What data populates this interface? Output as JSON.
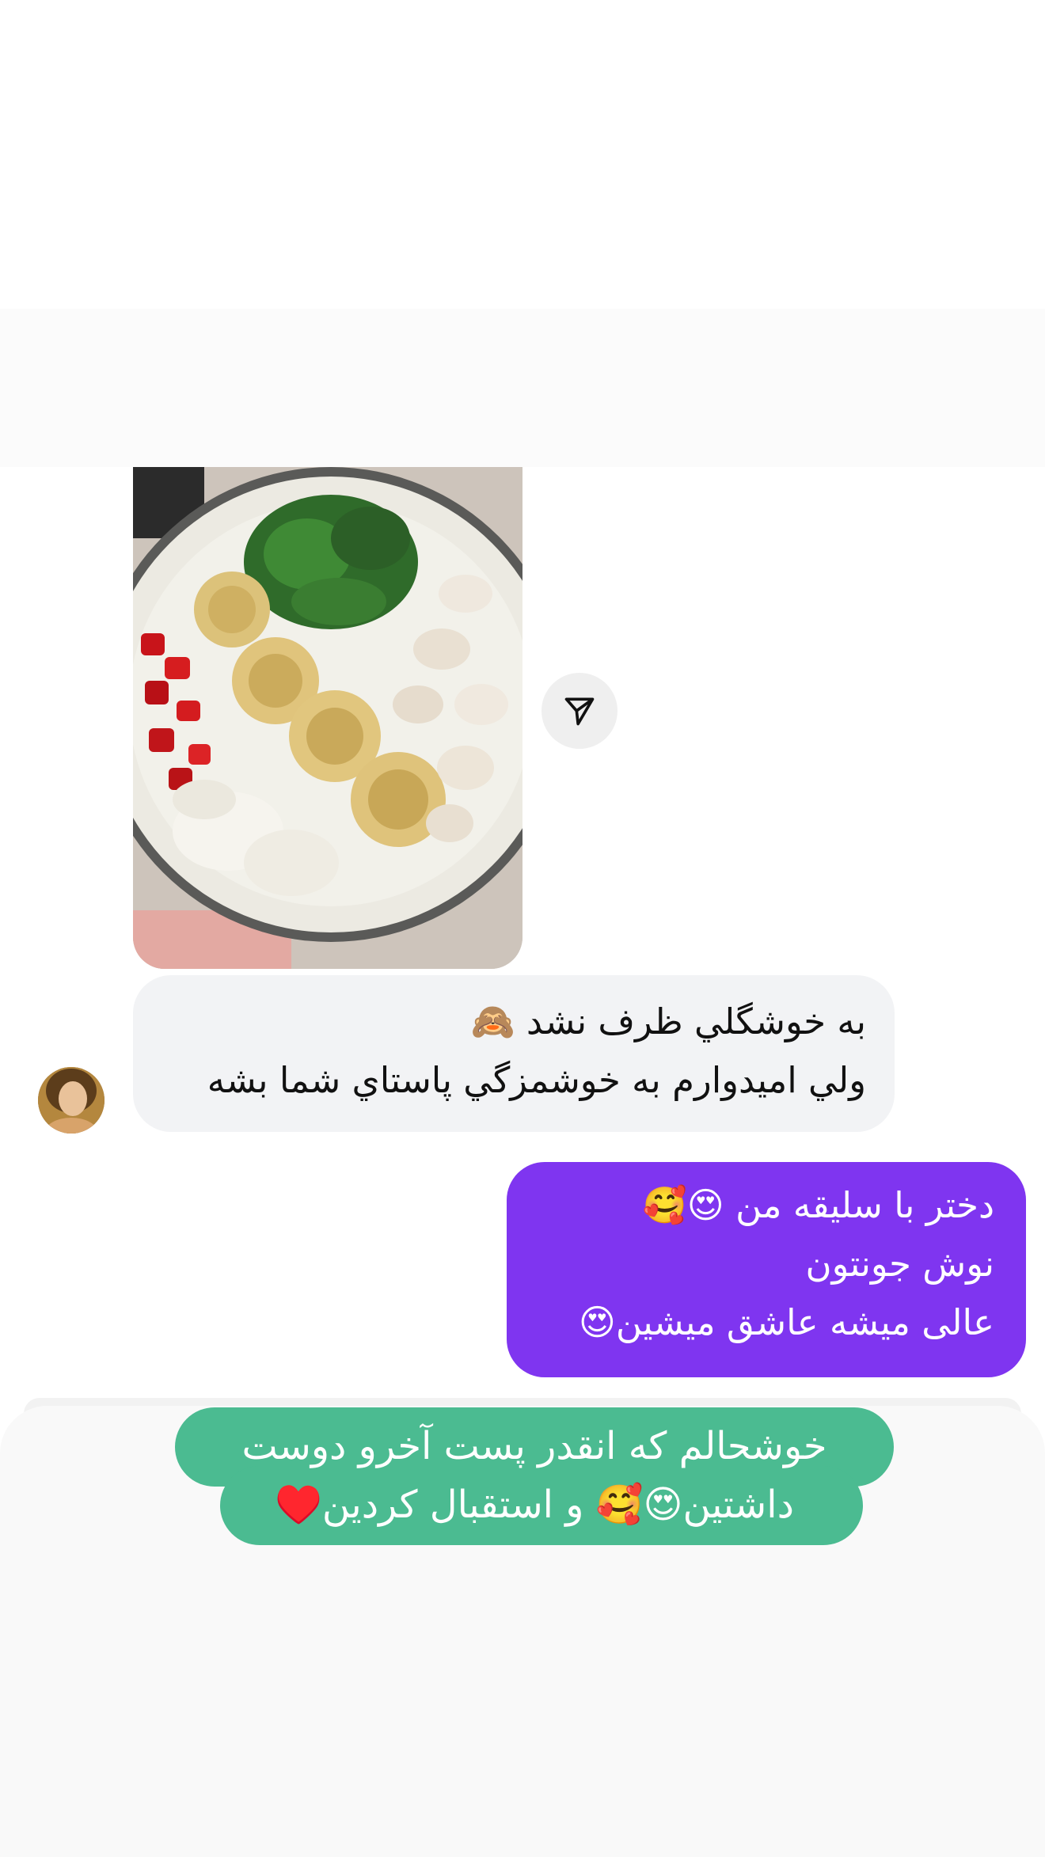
{
  "incoming_message": {
    "lines": [
      "به خوشگلي ظرف نشد 🙈",
      "ولي اميدوارم به خوشمزگي پاستاي شما بشه"
    ]
  },
  "outgoing_message": {
    "lines": [
      "دختر با سلیقه من 😍🥰",
      "نوش جونتون",
      "عالی میشه عاشق میشین😍"
    ]
  },
  "story_caption": {
    "lines": [
      "خوشحالم که  انقدر پست آخرو دوست",
      "داشتین😍🥰 و استقبال کردین♥️"
    ]
  },
  "icons": {
    "share": "send-icon",
    "avatar": "user-avatar"
  },
  "colors": {
    "outgoing_bubble": "#7f35f0",
    "incoming_bubble": "#f2f3f5",
    "caption_background": "#4bbb91"
  }
}
